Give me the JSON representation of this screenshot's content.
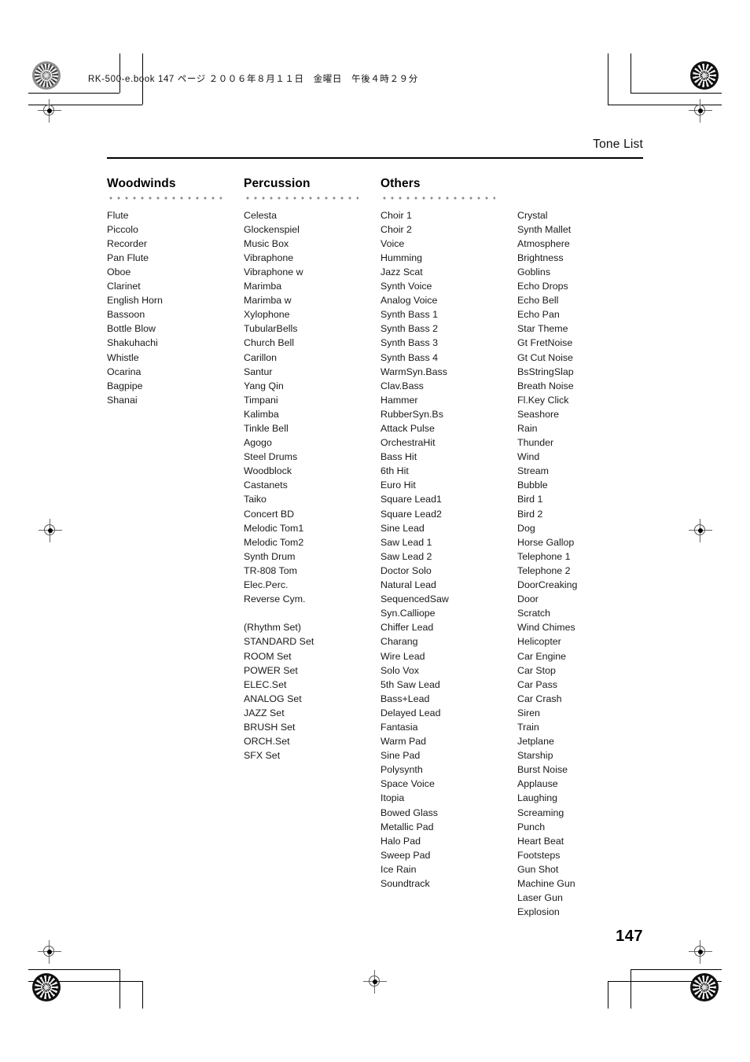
{
  "print_slug": "RK-500-e.book  147 ページ  ２００６年８月１１日　金曜日　午後４時２９分",
  "running_head": "Tone List",
  "page_number": "147",
  "columns": [
    {
      "title": "Woodwinds",
      "has_title": true,
      "items": [
        "Flute",
        "Piccolo",
        "Recorder",
        "Pan Flute",
        "Oboe",
        "Clarinet",
        "English Horn",
        "Bassoon",
        "Bottle Blow",
        "Shakuhachi",
        "Whistle",
        "Ocarina",
        "Bagpipe",
        "Shanai"
      ]
    },
    {
      "title": "Percussion",
      "has_title": true,
      "items": [
        "Celesta",
        "Glockenspiel",
        "Music Box",
        "Vibraphone",
        "Vibraphone w",
        "Marimba",
        "Marimba w",
        "Xylophone",
        "TubularBells",
        "Church Bell",
        "Carillon",
        "Santur",
        "Yang Qin",
        "Timpani",
        "Kalimba",
        "Tinkle Bell",
        "Agogo",
        "Steel Drums",
        "Woodblock",
        "Castanets",
        "Taiko",
        "Concert BD",
        "Melodic Tom1",
        "Melodic Tom2",
        "Synth Drum",
        "TR-808 Tom",
        "Elec.Perc.",
        "Reverse Cym.",
        "",
        "(Rhythm Set)",
        "STANDARD Set",
        "ROOM Set",
        "POWER Set",
        "ELEC.Set",
        "ANALOG Set",
        "JAZZ Set",
        "BRUSH Set",
        "ORCH.Set",
        "SFX Set"
      ]
    },
    {
      "title": "Others",
      "has_title": true,
      "items": [
        "Choir 1",
        "Choir 2",
        "Voice",
        "Humming",
        "Jazz Scat",
        "Synth Voice",
        "Analog Voice",
        "Synth Bass 1",
        "Synth Bass 2",
        "Synth Bass 3",
        "Synth Bass 4",
        "WarmSyn.Bass",
        "Clav.Bass",
        "Hammer",
        "RubberSyn.Bs",
        "Attack Pulse",
        "OrchestraHit",
        "Bass Hit",
        "6th Hit",
        "Euro Hit",
        "Square Lead1",
        "Square Lead2",
        "Sine Lead",
        "Saw Lead 1",
        "Saw Lead 2",
        "Doctor Solo",
        "Natural Lead",
        "SequencedSaw",
        "Syn.Calliope",
        "Chiffer Lead",
        "Charang",
        "Wire Lead",
        "Solo Vox",
        "5th Saw Lead",
        "Bass+Lead",
        "Delayed Lead",
        "Fantasia",
        "Warm Pad",
        "Sine Pad",
        "Polysynth",
        "Space Voice",
        "Itopia",
        "Bowed Glass",
        "Metallic Pad",
        "Halo Pad",
        "Sweep Pad",
        "Ice Rain",
        "Soundtrack"
      ]
    },
    {
      "title": "",
      "has_title": false,
      "items": [
        "Crystal",
        "Synth Mallet",
        "Atmosphere",
        "Brightness",
        "Goblins",
        "Echo Drops",
        "Echo Bell",
        "Echo Pan",
        "Star Theme",
        "Gt FretNoise",
        "Gt Cut Noise",
        "BsStringSlap",
        "Breath Noise",
        "Fl.Key Click",
        "Seashore",
        "Rain",
        "Thunder",
        "Wind",
        "Stream",
        "Bubble",
        "Bird 1",
        "Bird 2",
        "Dog",
        "Horse Gallop",
        "Telephone 1",
        "Telephone 2",
        "DoorCreaking",
        "Door",
        "Scratch",
        "Wind Chimes",
        "Helicopter",
        "Car Engine",
        "Car Stop",
        "Car Pass",
        "Car Crash",
        "Siren",
        "Train",
        "Jetplane",
        "Starship",
        "Burst Noise",
        "Applause",
        "Laughing",
        "Screaming",
        "Punch",
        "Heart Beat",
        "Footsteps",
        "Gun Shot",
        "Machine Gun",
        "Laser Gun",
        "Explosion"
      ]
    }
  ]
}
